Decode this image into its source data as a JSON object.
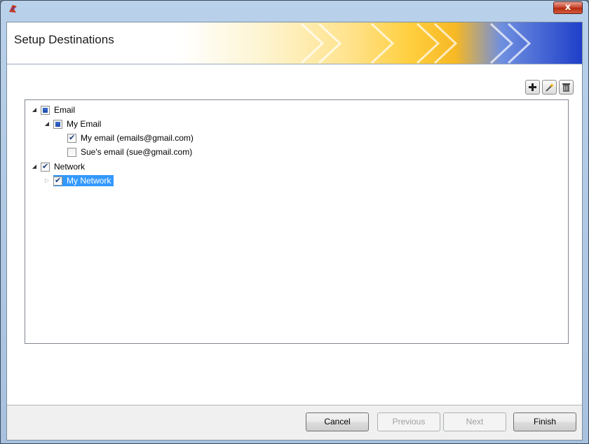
{
  "window": {
    "close_glyph": "x"
  },
  "header": {
    "title": "Setup Destinations"
  },
  "toolbar": {
    "add_icon": "plus-icon",
    "edit_icon": "wand-icon",
    "delete_icon": "trash-icon"
  },
  "tree": {
    "email": {
      "label": "Email",
      "state": "partial",
      "expanded": true
    },
    "my_email": {
      "label": "My Email",
      "state": "partial",
      "expanded": true
    },
    "my_email_item": {
      "label": "My email (emails@gmail.com)",
      "state": "checked"
    },
    "sue_email_item": {
      "label": "Sue's email (sue@gmail.com)",
      "state": "unchecked"
    },
    "network": {
      "label": "Network",
      "state": "checked",
      "expanded": true
    },
    "my_network": {
      "label": "My Network",
      "state": "checked",
      "expanded": false,
      "selected": true
    }
  },
  "footer": {
    "cancel_label": "Cancel",
    "previous_label": "Previous",
    "next_label": "Next",
    "finish_label": "Finish"
  },
  "colors": {
    "selection": "#3399ff",
    "header_accent": "#f7b824",
    "header_end": "#1f3fc9"
  }
}
